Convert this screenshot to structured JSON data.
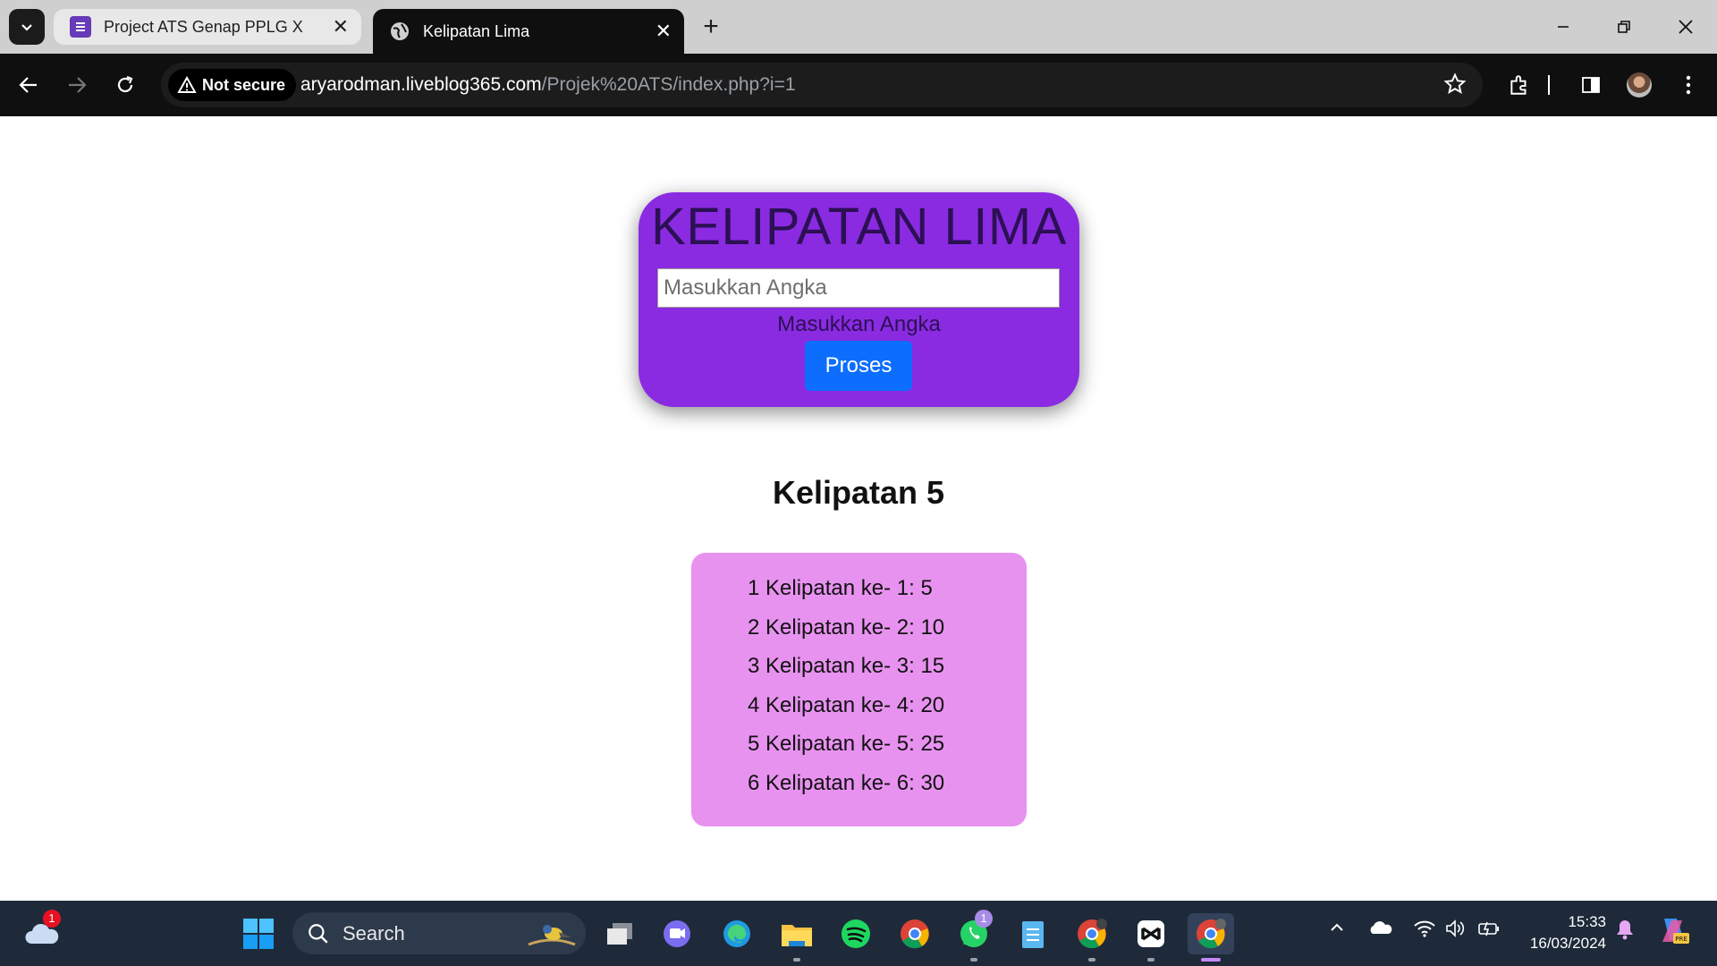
{
  "browser": {
    "tabs": [
      {
        "title": "Project ATS Genap PPLG X",
        "favicon": "google-forms-icon",
        "active": false
      },
      {
        "title": "Kelipatan Lima",
        "favicon": "globe-icon",
        "active": true
      }
    ],
    "security_label": "Not secure",
    "url_host": "aryarodman.liveblog365.com",
    "url_path": "/Projek%20ATS/index.php?i=1"
  },
  "card": {
    "title": "KELIPATAN LIMA",
    "input_placeholder": "Masukkan Angka",
    "hint": "Masukkan Angka",
    "button": "Proses"
  },
  "result": {
    "heading": "Kelipatan 5",
    "items": [
      "1 Kelipatan ke- 1: 5",
      "2 Kelipatan ke- 2: 10",
      "3 Kelipatan ke- 3: 15",
      "4 Kelipatan ke- 4: 20",
      "5 Kelipatan ke- 5: 25",
      "6 Kelipatan ke- 6: 30"
    ]
  },
  "taskbar": {
    "search_label": "Search",
    "weather_badge": "1",
    "whatsapp_badge": "1",
    "time": "15:33",
    "date": "16/03/2024"
  },
  "colors": {
    "card_bg": "#8a2be2",
    "button_bg": "#0d6efd",
    "result_bg": "#e892f0"
  }
}
